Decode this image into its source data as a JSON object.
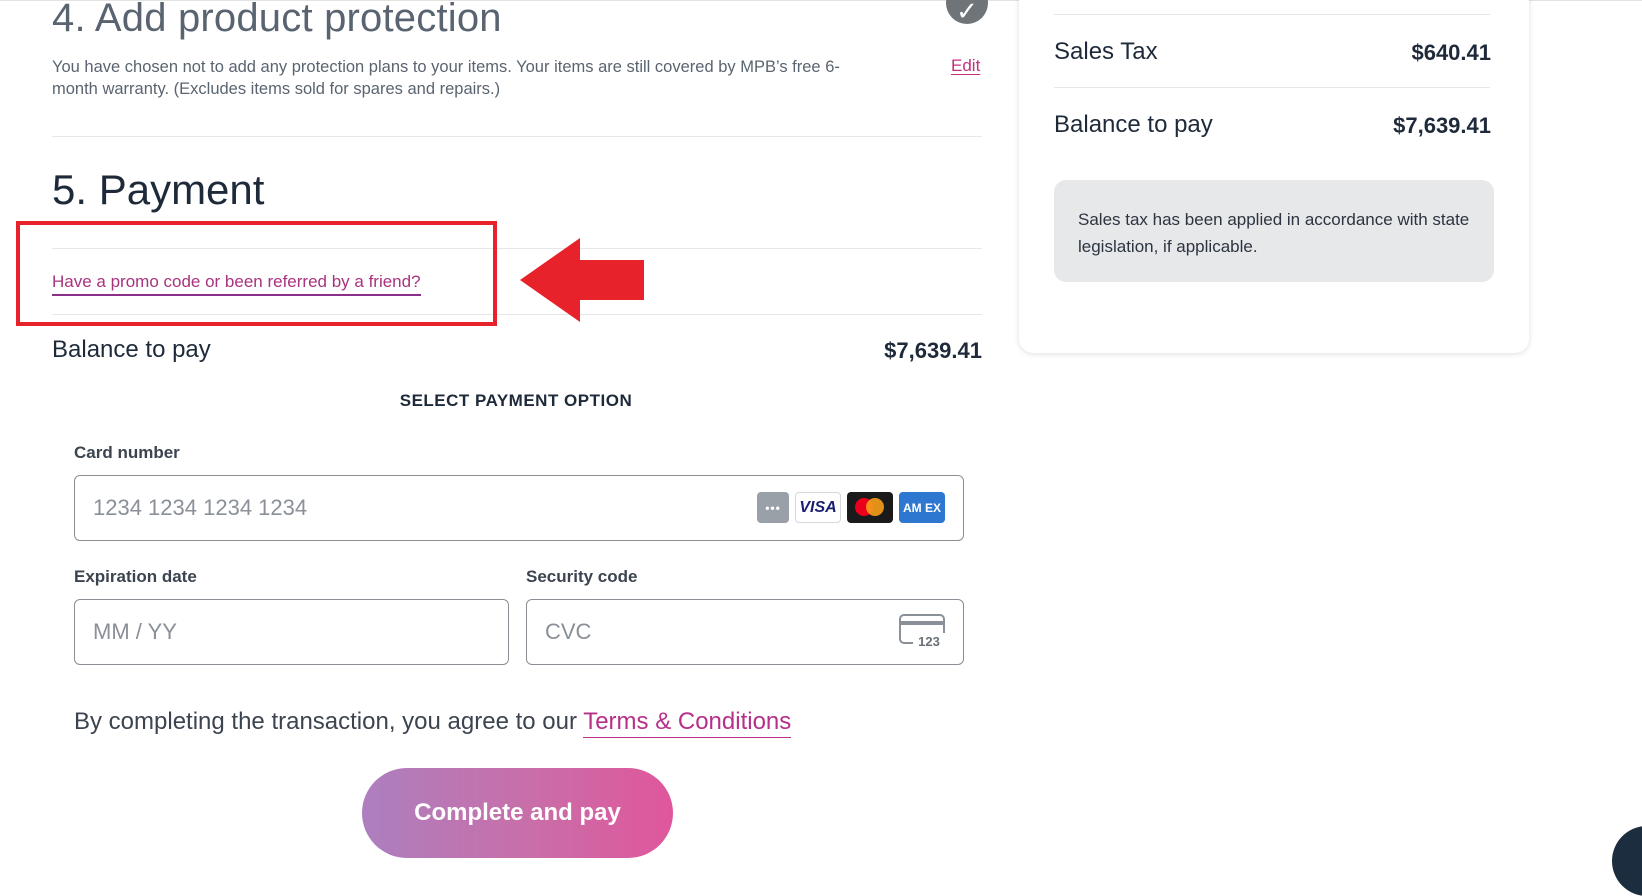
{
  "section4": {
    "title": "4. Add product protection",
    "description": "You have chosen not to add any protection plans to your items. Your items are still covered by MPB’s free 6-month warranty. (Excludes items sold for spares and repairs.)",
    "edit_label": "Edit",
    "check_icon": "✓"
  },
  "section5": {
    "title": "5. Payment",
    "promo_link": "Have a promo code or been referred by a friend?",
    "balance_label": "Balance to pay",
    "balance_value": "$7,639.41",
    "select_option": "SELECT PAYMENT OPTION"
  },
  "card_form": {
    "card_number_label": "Card number",
    "card_number_placeholder": "1234 1234 1234 1234",
    "card_icons": [
      "generic-card-icon",
      "visa-icon",
      "mastercard-icon",
      "amex-icon"
    ],
    "visa_text": "VISA",
    "amex_text": "AM EX",
    "expiration_label": "Expiration date",
    "expiration_placeholder": "MM / YY",
    "security_label": "Security code",
    "security_placeholder": "CVC",
    "cvc_icon_text": "123"
  },
  "terms": {
    "prefix": "By completing the transaction, you agree to our ",
    "link": "Terms & Conditions"
  },
  "pay_button": "Complete and pay",
  "summary": {
    "sales_tax_label": "Sales Tax",
    "sales_tax_value": "$640.41",
    "balance_label": "Balance to pay",
    "balance_value": "$7,639.41",
    "tax_note": "Sales tax has been applied in accordance with state legislation, if applicable."
  },
  "colors": {
    "accent_link": "#b6308a",
    "highlight": "#e8222a",
    "button_gradient": [
      "#ad7fbf",
      "#e0569c"
    ]
  }
}
